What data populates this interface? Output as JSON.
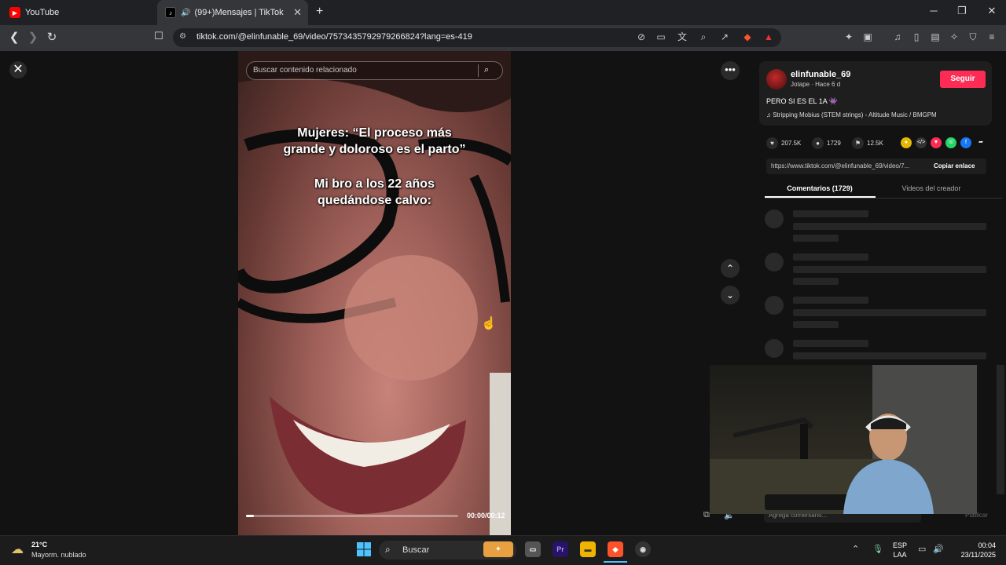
{
  "browser": {
    "tabs": [
      {
        "title": "YouTube",
        "icon": "youtube-icon"
      },
      {
        "title": "(99+)Mensajes | TikTok",
        "icon": "tiktok-icon",
        "active": true
      }
    ],
    "url": "tiktok.com/@elinfunable_69/video/7573435792979266824?lang=es-419",
    "shields_count": "4"
  },
  "video": {
    "search_placeholder": "Buscar contenido relacionado",
    "caption_line1": "Mujeres: “El proceso más",
    "caption_line2": "grande y doloroso es el parto”",
    "caption_line3": "Mi bro a los 22 años",
    "caption_line4": "quedándose calvo:",
    "timecode": "00:00/00:12",
    "progress": 0.02
  },
  "post": {
    "username": "elinfunable_69",
    "subline": "Jotape · Hace 6 d",
    "follow_label": "Seguir",
    "description": "PERO SI ES EL 1A 👾",
    "music": "♫  Stripping Mobius (STEM strings) - Altitude Music / BMGPM",
    "likes": "207.5K",
    "comments": "1729",
    "saves": "12.5K",
    "link": "https://www.tiktok.com/@elinfunable_69/video/7...",
    "copy_label": "Copiar enlace",
    "tab_comments": "Comentarios (1729)",
    "tab_creator": "Videos del creador",
    "comment_placeholder": "Agrega comentario...",
    "publish_label": "Publicar"
  },
  "taskbar": {
    "temperature": "21°C",
    "condition": "Mayorm. nublado",
    "search_label": "Buscar",
    "lang_line1": "ESP",
    "lang_line2": "LAA",
    "time": "00:04",
    "date": "23/11/2025"
  },
  "colors": {
    "accent": "#fe2c55",
    "background": "#121212"
  }
}
